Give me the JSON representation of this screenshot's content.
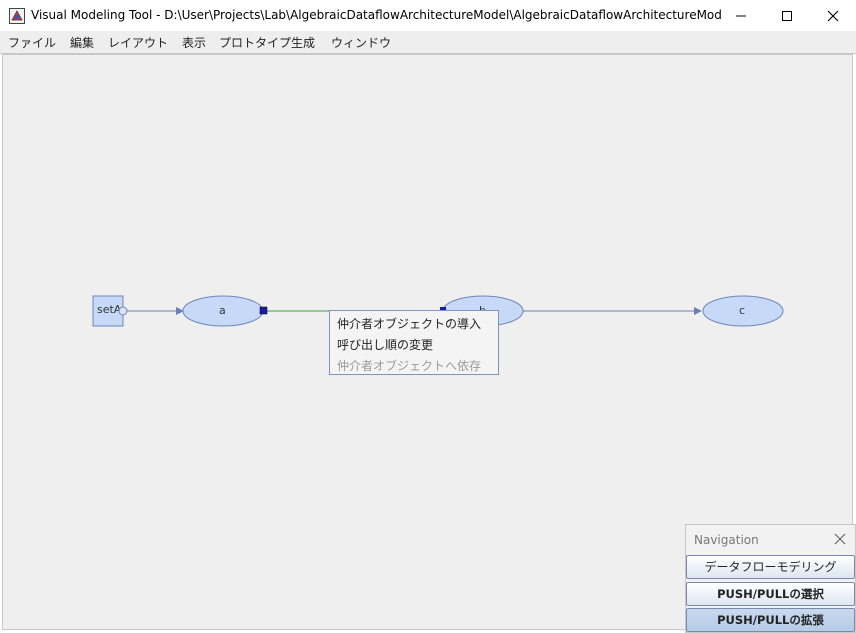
{
  "window": {
    "title": "Visual Modeling Tool - D:\\User\\Projects\\Lab\\AlgebraicDataflowArchitectureModel\\AlgebraicDataflowArchitectureModel\\models..."
  },
  "menubar": {
    "items": [
      "ファイル",
      "編集",
      "レイアウト",
      "表示",
      "プロトタイプ生成",
      "ウィンドウ"
    ]
  },
  "graph": {
    "nodes": {
      "setA": "setA",
      "a": "a",
      "b": "b",
      "c": "c"
    }
  },
  "context_menu": {
    "items": [
      {
        "label": "仲介者オブジェクトの導入",
        "enabled": true
      },
      {
        "label": "呼び出し順の変更",
        "enabled": true
      },
      {
        "label": "仲介者オブジェクトへ依存",
        "enabled": false
      }
    ]
  },
  "navigation": {
    "title": "Navigation",
    "buttons": [
      "データフローモデリング",
      "PUSH/PULLの選択",
      "PUSH/PULLの拡張"
    ],
    "active_button": "PUSH/PULLの拡張"
  },
  "colors": {
    "node_fill": "#c6d9f7",
    "node_stroke": "#7086b8",
    "edge": "#6a7fb5",
    "selected_edge": "#3aa03a",
    "handle": "#1a1ab0"
  },
  "icons": {
    "app": "java-app-icon",
    "minimize": "minimize-icon",
    "maximize": "maximize-icon",
    "close": "close-icon",
    "nav_close": "close-icon"
  }
}
